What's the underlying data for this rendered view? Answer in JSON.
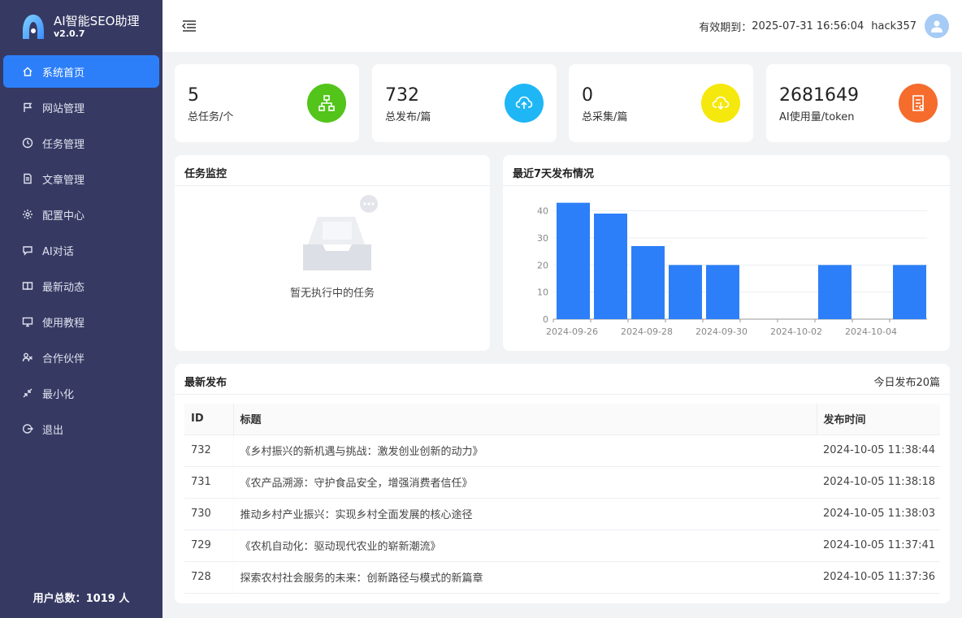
{
  "app": {
    "title": "AI智能SEO助理",
    "version": "v2.0.7"
  },
  "sidebar": {
    "items": [
      {
        "label": "系统首页",
        "icon": "home-icon",
        "active": true
      },
      {
        "label": "网站管理",
        "icon": "flag-icon",
        "active": false
      },
      {
        "label": "任务管理",
        "icon": "clock-icon",
        "active": false
      },
      {
        "label": "文章管理",
        "icon": "document-icon",
        "active": false
      },
      {
        "label": "配置中心",
        "icon": "gear-icon",
        "active": false
      },
      {
        "label": "AI对话",
        "icon": "chat-icon",
        "active": false
      },
      {
        "label": "最新动态",
        "icon": "book-icon",
        "active": false
      },
      {
        "label": "使用教程",
        "icon": "monitor-icon",
        "active": false
      },
      {
        "label": "合作伙伴",
        "icon": "partner-icon",
        "active": false
      },
      {
        "label": "最小化",
        "icon": "shrink-icon",
        "active": false
      },
      {
        "label": "退出",
        "icon": "logout-icon",
        "active": false
      }
    ],
    "user_count_label": "用户总数：1019 人"
  },
  "header": {
    "expiry_label": "有效期到：",
    "expiry_value": "2025-07-31 16:56:04",
    "username": "hack357"
  },
  "stats": [
    {
      "value": "5",
      "label": "总任务/个",
      "color": "#52c41a",
      "icon": "sitemap-icon"
    },
    {
      "value": "732",
      "label": "总发布/篇",
      "color": "#1fb6f5",
      "icon": "cloud-upload-icon"
    },
    {
      "value": "0",
      "label": "总采集/篇",
      "color": "#f5e80c",
      "icon": "cloud-download-icon"
    },
    {
      "value": "2681649",
      "label": "AI使用量/token",
      "color": "#f56c2d",
      "icon": "receipt-icon"
    }
  ],
  "task_monitor": {
    "title": "任务监控",
    "empty_text": "暂无执行中的任务"
  },
  "chart_panel": {
    "title": "最近7天发布情况"
  },
  "chart_data": {
    "type": "bar",
    "categories": [
      "2024-09-26",
      "2024-09-27",
      "2024-09-28",
      "2024-09-29",
      "2024-09-30",
      "2024-10-01",
      "2024-10-02",
      "2024-10-03",
      "2024-10-04",
      "2024-10-05"
    ],
    "values": [
      43,
      39,
      27,
      20,
      20,
      0,
      0,
      20,
      0,
      20
    ],
    "tick_labels": [
      "2024-09-26",
      "2024-09-28",
      "2024-09-30",
      "2024-10-02",
      "2024-10-04"
    ],
    "yticks": [
      0,
      10,
      20,
      30,
      40
    ],
    "ylim": [
      0,
      45
    ],
    "color": "#2d7ff9",
    "title": "",
    "xlabel": "",
    "ylabel": ""
  },
  "latest": {
    "title": "最新发布",
    "today_label": "今日发布20篇",
    "columns": [
      "ID",
      "标题",
      "发布时间"
    ],
    "rows": [
      {
        "id": "732",
        "title": "《乡村振兴的新机遇与挑战：激发创业创新的动力》",
        "time": "2024-10-05 11:38:44"
      },
      {
        "id": "731",
        "title": "《农产品溯源：守护食品安全，增强消费者信任》",
        "time": "2024-10-05 11:38:18"
      },
      {
        "id": "730",
        "title": "推动乡村产业振兴：实现乡村全面发展的核心途径",
        "time": "2024-10-05 11:38:03"
      },
      {
        "id": "729",
        "title": "《农机自动化：驱动现代农业的崭新潮流》",
        "time": "2024-10-05 11:37:41"
      },
      {
        "id": "728",
        "title": "探索农村社会服务的未来：创新路径与模式的新篇章",
        "time": "2024-10-05 11:37:36"
      }
    ]
  }
}
